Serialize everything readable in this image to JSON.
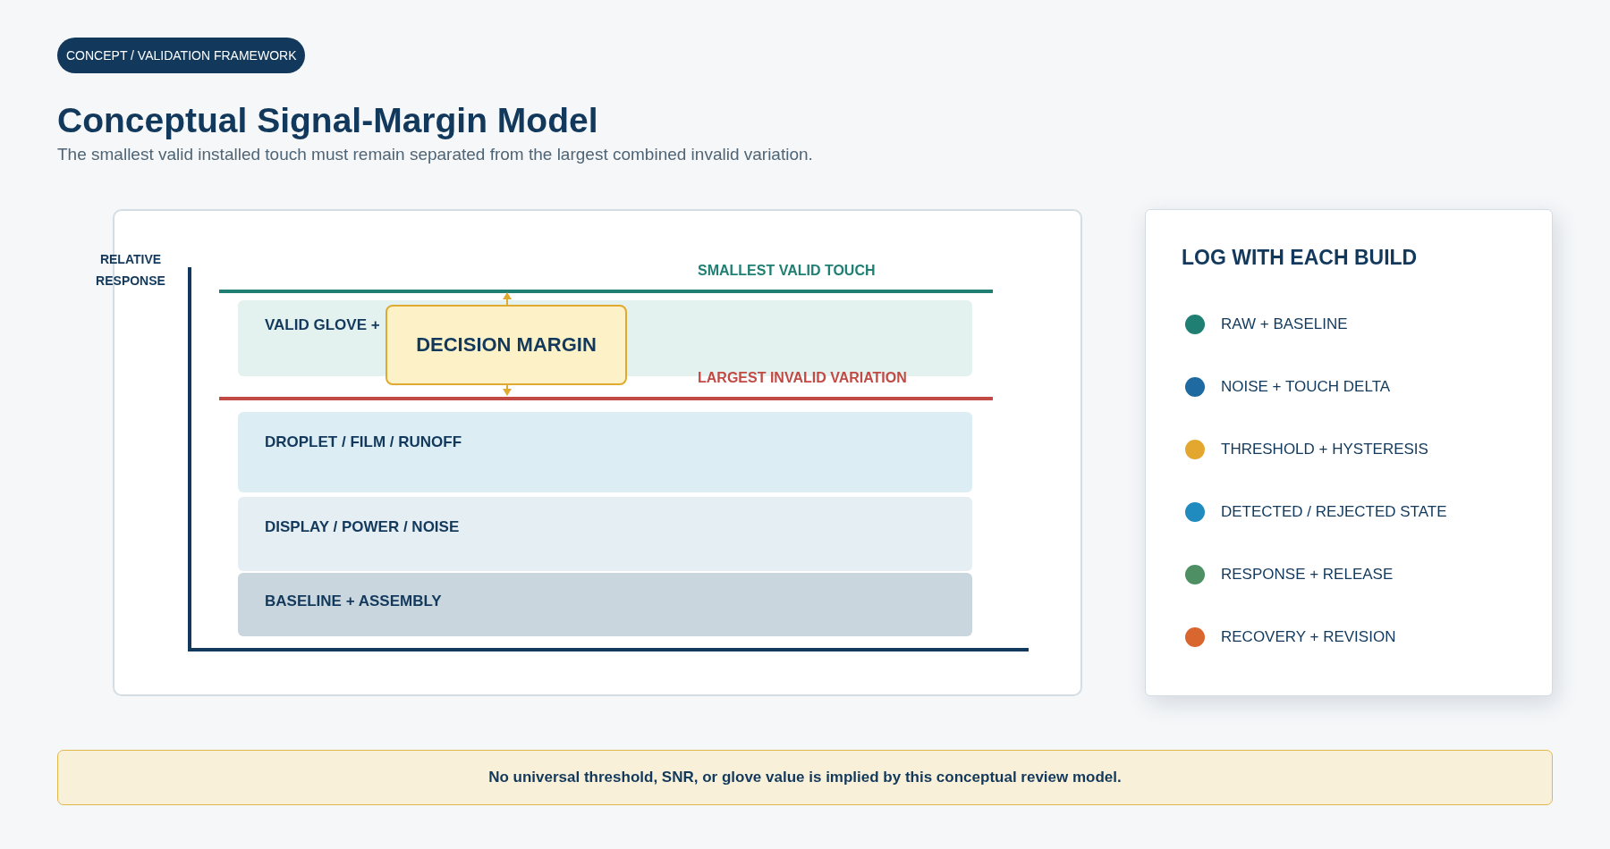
{
  "badge": "CONCEPT / VALIDATION FRAMEWORK",
  "title": "Conceptual Signal-Margin Model",
  "subtitle": "The smallest valid installed touch must remain separated from the largest combined invalid variation.",
  "diagram": {
    "axis_label": "RELATIVE RESPONSE",
    "lines": [
      {
        "kind": "valid",
        "label": "SMALLEST VALID TOUCH"
      },
      {
        "kind": "invalid",
        "label": "LARGEST INVALID VARIATION"
      }
    ],
    "bands": [
      {
        "kind": "valid",
        "label": "VALID GLOVE +"
      },
      {
        "kind": "droplet",
        "label": "DROPLET / FILM / RUNOFF"
      },
      {
        "kind": "display",
        "label": "DISPLAY / POWER / NOISE"
      },
      {
        "kind": "baseline",
        "label": "BASELINE + ASSEMBLY"
      }
    ],
    "margin_label": "DECISION MARGIN"
  },
  "legend": {
    "title": "LOG WITH EACH BUILD",
    "items": [
      {
        "label": "RAW + BASELINE",
        "color": "#1f7f73"
      },
      {
        "label": "NOISE + TOUCH DELTA",
        "color": "#1f6aa0"
      },
      {
        "label": "THRESHOLD + HYSTERESIS",
        "color": "#e3a72f"
      },
      {
        "label": "DETECTED / REJECTED STATE",
        "color": "#1f8bbf"
      },
      {
        "label": "RESPONSE + RELEASE",
        "color": "#4e8f64"
      },
      {
        "label": "RECOVERY + REVISION",
        "color": "#d9652f"
      }
    ]
  },
  "note": "No universal threshold, SNR, or glove value is implied by this conceptual review model."
}
